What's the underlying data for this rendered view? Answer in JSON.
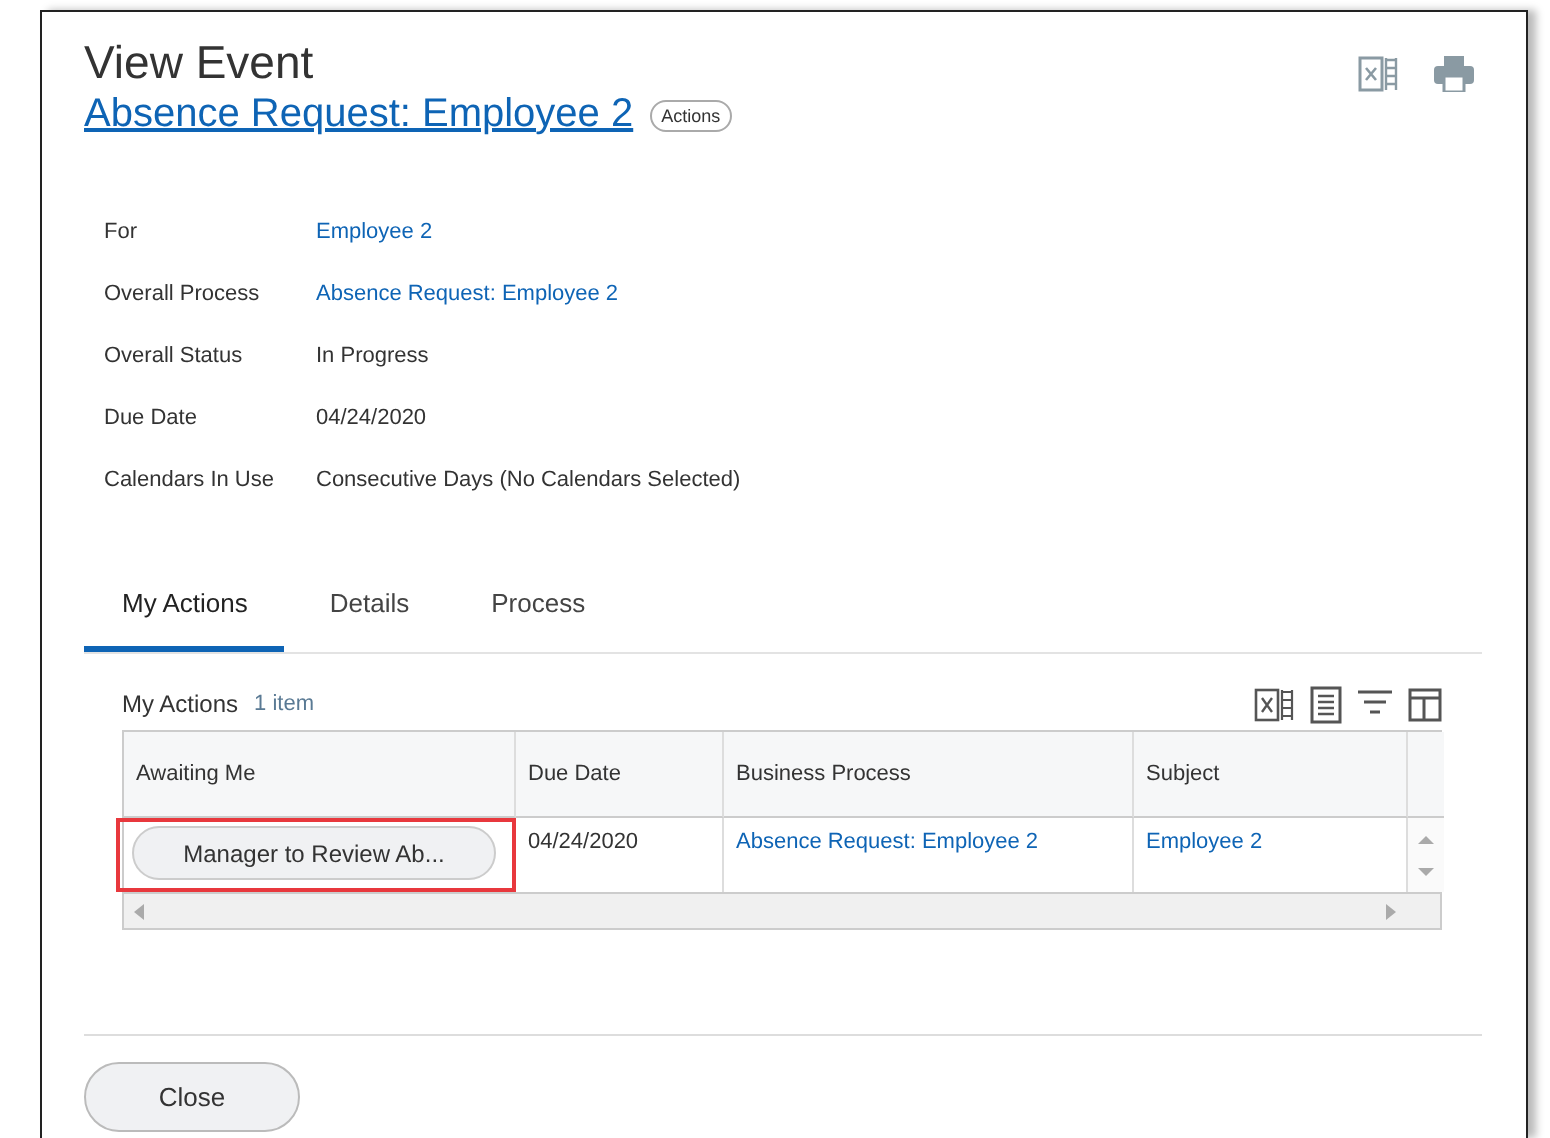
{
  "dialog": {
    "title": "View Event",
    "subtitle_link": "Absence Request: Employee 2",
    "actions_button": "Actions"
  },
  "fields": [
    {
      "label": "For",
      "value": "Employee 2",
      "kind": "link"
    },
    {
      "label": "Overall Process",
      "value": "Absence Request: Employee 2",
      "kind": "link"
    },
    {
      "label": "Overall Status",
      "value": "In Progress",
      "kind": "text"
    },
    {
      "label": "Due Date",
      "value": "04/24/2020",
      "kind": "text"
    },
    {
      "label": "Calendars In Use",
      "value": "Consecutive Days (No Calendars Selected)",
      "kind": "text"
    }
  ],
  "tabs": [
    {
      "label": "My Actions",
      "selected": true
    },
    {
      "label": "Details",
      "selected": false
    },
    {
      "label": "Process",
      "selected": false
    }
  ],
  "table": {
    "title": "My Actions",
    "count": "1 item",
    "columns": [
      "Awaiting Me",
      "Due Date",
      "Business Process",
      "Subject"
    ],
    "rows": [
      {
        "action": "Manager to Review Ab...",
        "highlighted": true,
        "due_date": "04/24/2020",
        "business_process": "Absence Request: Employee 2",
        "subject": "Employee 2"
      }
    ]
  },
  "buttons": [
    "Close"
  ]
}
